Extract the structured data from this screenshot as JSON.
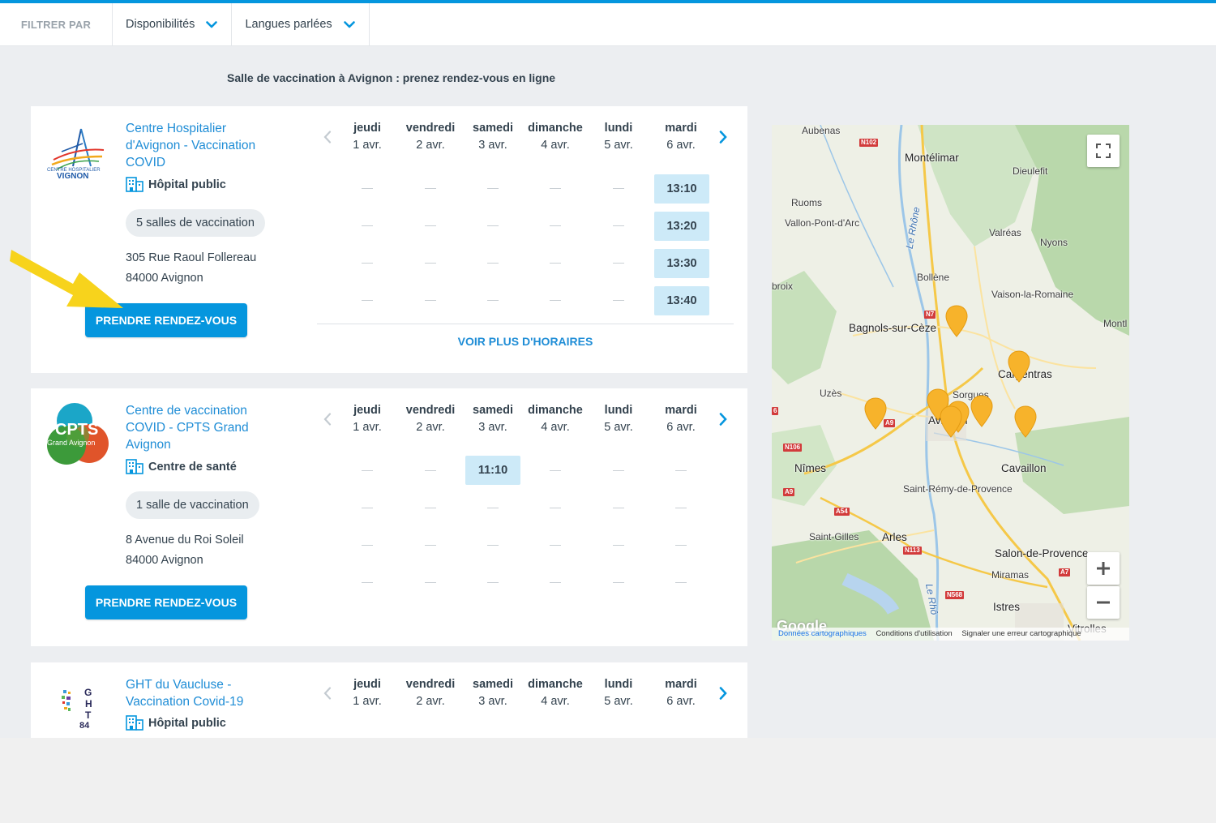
{
  "filter": {
    "label": "FILTRER PAR",
    "items": [
      "Disponibilités",
      "Langues parlées"
    ]
  },
  "page_title": "Salle de vaccination à Avignon : prenez rendez-vous en ligne",
  "days": [
    {
      "name": "jeudi",
      "date": "1 avr."
    },
    {
      "name": "vendredi",
      "date": "2 avr."
    },
    {
      "name": "samedi",
      "date": "3 avr."
    },
    {
      "name": "dimanche",
      "date": "4 avr."
    },
    {
      "name": "lundi",
      "date": "5 avr."
    },
    {
      "name": "mardi",
      "date": "6 avr."
    }
  ],
  "centers": [
    {
      "name_lines": [
        "Centre Hospitalier",
        "d'Avignon - Vaccination",
        "COVID"
      ],
      "type": "Hôpital public",
      "rooms": "5 salles de vaccination",
      "address_line1": "305 Rue Raoul Follereau",
      "address_line2": "84000 Avignon",
      "book_label": "PRENDRE RENDEZ-VOUS",
      "more_label": "VOIR PLUS D'HORAIRES",
      "logo_text_1": "CENTRE HOSPITALIER",
      "logo_text_2": "VIGNON",
      "slots": [
        "13:10",
        "13:20",
        "13:30",
        "13:40"
      ]
    },
    {
      "name_lines": [
        "Centre de vaccination",
        "COVID - CPTS Grand",
        "Avignon"
      ],
      "type": "Centre de santé",
      "rooms": "1 salle de vaccination",
      "address_line1": "8 Avenue du Roi Soleil",
      "address_line2": "84000 Avignon",
      "book_label": "PRENDRE RENDEZ-VOUS",
      "logo_text_1": "CPTS",
      "logo_text_2": "Grand Avignon",
      "slots": [
        "11:10"
      ]
    },
    {
      "name_lines": [
        "GHT du Vaucluse -",
        "Vaccination Covid-19"
      ],
      "type": "Hôpital public",
      "logo_text_1": "G",
      "logo_text_2": "H",
      "logo_text_3": "T",
      "logo_text_4": "84"
    }
  ],
  "map": {
    "labels": {
      "aubenas": "Aubenas",
      "montelimar": "Montélimar",
      "dieulefit": "Dieulefit",
      "ruoms": "Ruoms",
      "vallon": "Vallon-Pont-d'Arc",
      "lerhone": "Le Rhône",
      "valreas": "Valréas",
      "nyons": "Nyons",
      "bollene": "Bollène",
      "broix": "broix",
      "vaison": "Vaison-la-Romaine",
      "bagnols": "Bagnols-sur-Cèze",
      "mont": "Montl",
      "carpentras": "Carpentras",
      "uzes": "Uzès",
      "sorgues": "Sorgues",
      "avignon": "Avignon",
      "nimes": "Nîmes",
      "cavaillon": "Cavaillon",
      "stremy": "Saint-Rémy-de-Provence",
      "stgilles": "Saint-Gilles",
      "arles": "Arles",
      "salon": "Salon-de-Provence",
      "miramas": "Miramas",
      "istres": "Istres",
      "lerhone2": "Le Rhô",
      "vitrolles": "Vitrolles"
    },
    "roads": {
      "n102": "N102",
      "n7": "N7",
      "a9": "A9",
      "n106": "N106",
      "a9b": "A9",
      "a54": "A54",
      "n113": "N113",
      "a7": "A7",
      "n568": "N568",
      "a6": "6"
    },
    "google": "Google",
    "attribution": [
      "Données cartographiques",
      "Conditions d'utilisation",
      "Signaler une erreur cartographique"
    ],
    "marker_color": "#f7b32b"
  },
  "colors": {
    "accent": "#0596de",
    "link": "#1f8dd6",
    "slot_bg": "#cdeaf8",
    "annotation_arrow": "#f7d31c"
  }
}
